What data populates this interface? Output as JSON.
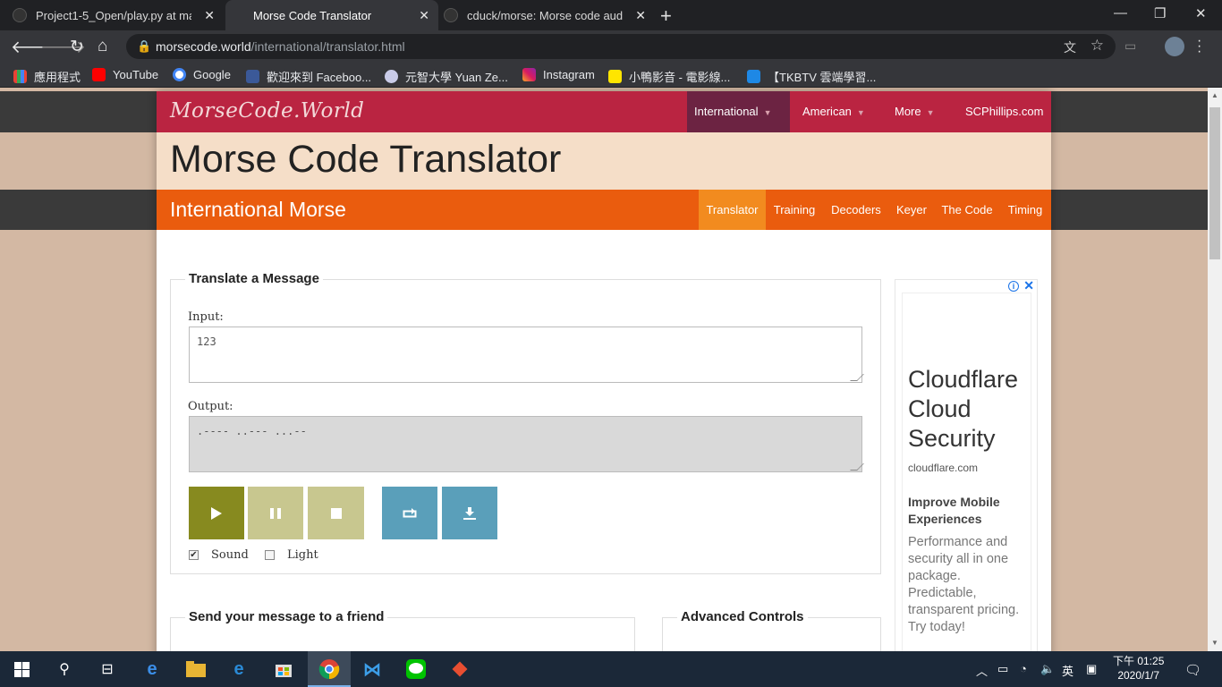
{
  "browser": {
    "tabs": [
      {
        "title": "Project1-5_Open/play.py at ma",
        "active": false
      },
      {
        "title": "Morse Code Translator",
        "active": true
      },
      {
        "title": "cduck/morse: Morse code audi",
        "active": false
      }
    ],
    "url_domain": "morsecode.world",
    "url_path": "/international/translator.html",
    "bookmarks": [
      "應用程式",
      "YouTube",
      "Google",
      "歡迎來到 Faceboo...",
      "元智大學 Yuan Ze...",
      "Instagram",
      "小鴨影音 - 電影線...",
      "【TKBTV 雲端學習..."
    ]
  },
  "site": {
    "logo": "MorseCode.World",
    "nav": [
      "International",
      "American",
      "More",
      "SCPhillips.com"
    ],
    "page_title": "Morse Code Translator",
    "section_title": "International Morse",
    "subnav": [
      "Translator",
      "Training",
      "Decoders",
      "Keyer",
      "The Code",
      "Timing"
    ]
  },
  "translator": {
    "legend": "Translate a Message",
    "input_label": "Input:",
    "input_value": "123",
    "output_label": "Output:",
    "output_value": ".---- ..--- ...--",
    "sound_label": "Sound",
    "sound_checked": true,
    "light_label": "Light",
    "light_checked": false
  },
  "send_legend": "Send your message to a friend",
  "advanced_legend": "Advanced Controls",
  "ad": {
    "headline": "Cloudflare Cloud Security",
    "domain": "cloudflare.com",
    "subhead": "Improve Mobile Experiences",
    "body": "Performance and security all in one package. Predictable, transparent pricing. Try today!"
  },
  "taskbar": {
    "ime": "英",
    "time": "下午 01:25",
    "date": "2020/1/7"
  },
  "colors": {
    "nav_bg": "#ba2441",
    "nav_active": "#6c2342",
    "title_bg": "#f5dec8",
    "subnav_bg": "#ea5c0e",
    "subnav_active": "#f28b1f",
    "play_btn": "#878a1f",
    "pause_stop_btn": "#c8c78f",
    "aux_btn": "#5a9fba"
  }
}
